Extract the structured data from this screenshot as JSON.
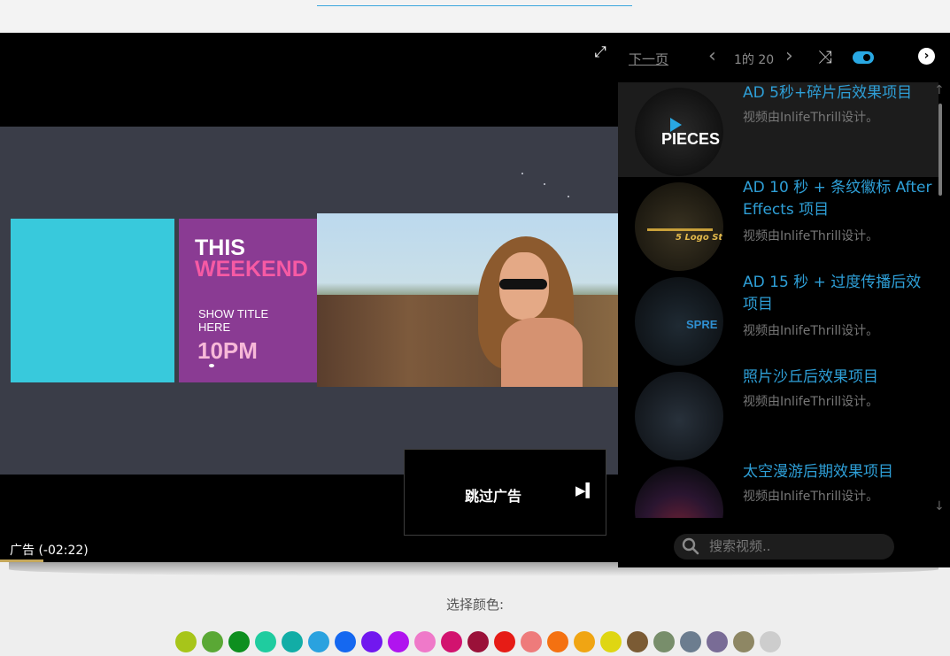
{
  "player": {
    "fullscreen_icon": "expand-arrows-icon",
    "video": {
      "title_line1": "THIS",
      "title_line2": "WEEKEND",
      "show_title": "SHOW TITLE HERE",
      "time": "10PM"
    },
    "skip_button_label": "跳过广告",
    "skip_icon": "skip-next-icon",
    "ad_countdown": "广告 (-02:22)",
    "ad_progress": 0.07
  },
  "playlist": {
    "next_page_label": "下一页",
    "page_count": "1的 20",
    "shuffle_icon": "shuffle-icon",
    "autoplay_enabled": true,
    "items": [
      {
        "title": "AD 5秒+碎片后效果项目",
        "author": "视频由InlifeThrill设计。",
        "thumb_text": "PIECES",
        "active": true
      },
      {
        "title": "AD 10 秒 + 条纹徽标 After Effects 项目",
        "author": "视频由InlifeThrill设计。",
        "thumb_text": "5 Logo St",
        "active": false
      },
      {
        "title": "AD 15 秒 + 过度传播后效项目",
        "author": "视频由InlifeThrill设计。",
        "thumb_text": "SPRE",
        "active": false
      },
      {
        "title": "照片沙丘后效果项目",
        "author": "视频由InlifeThrill设计。",
        "thumb_text": "",
        "active": false
      },
      {
        "title": "太空漫游后期效果项目",
        "author": "视频由InlifeThrill设计。",
        "thumb_text": "",
        "active": false
      }
    ],
    "search": {
      "placeholder": "搜索视频.."
    }
  },
  "color_picker": {
    "label": "选择颜色:",
    "swatches": [
      "#a7c51a",
      "#5aa835",
      "#0e8f1f",
      "#1fcc9f",
      "#12ada6",
      "#2aa2df",
      "#1568f0",
      "#7118ef",
      "#b014ef",
      "#ef79c9",
      "#d2136f",
      "#9a1139",
      "#e61c16",
      "#ee7b7b",
      "#f47111",
      "#f0a513",
      "#dfd612",
      "#7b5b34",
      "#788e6b",
      "#6c7d8f",
      "#796c96",
      "#8e8764",
      "#cdcdcd"
    ]
  }
}
